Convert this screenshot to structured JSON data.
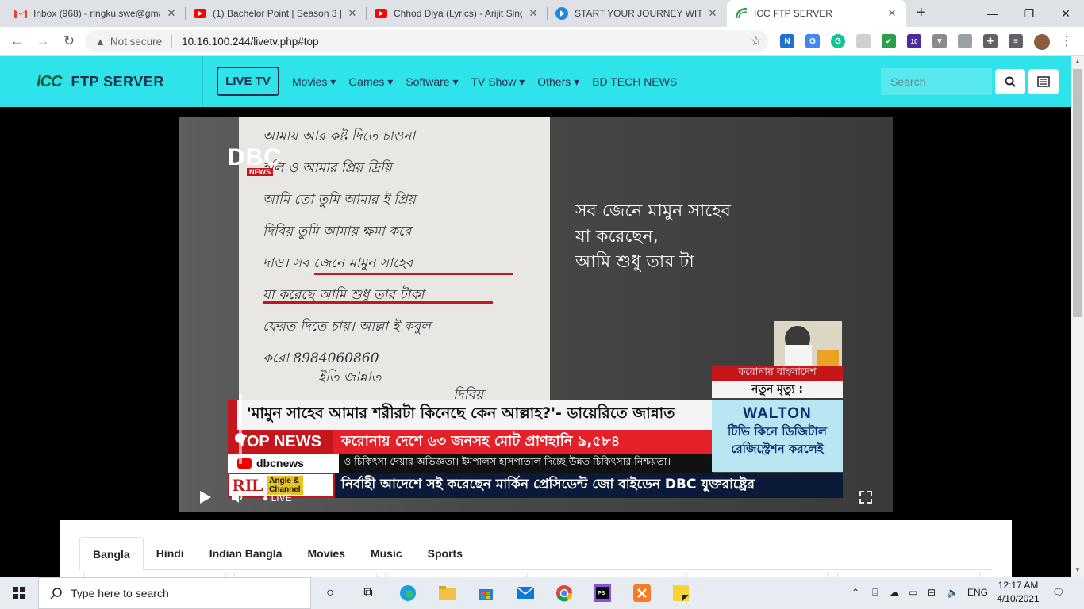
{
  "browser": {
    "tabs": [
      {
        "title": "Inbox (968) - ringku.swe@gma",
        "icon": "gmail-icon"
      },
      {
        "title": "(1) Bachelor Point | Season 3 |",
        "icon": "youtube-icon"
      },
      {
        "title": "Chhod Diya (Lyrics) - Arijit Sing",
        "icon": "youtube-icon"
      },
      {
        "title": "START YOUR JOURNEY WITH U",
        "icon": "app-icon"
      },
      {
        "title": "ICC FTP SERVER",
        "icon": "icc-icon",
        "active": true
      }
    ],
    "not_secure": "Not secure",
    "url": "10.16.100.244/livetv.php#top",
    "ext_badge": "10"
  },
  "site": {
    "logo_mark": "ICC",
    "logo_text": "FTP SERVER",
    "live_tv": "LIVE TV",
    "menu": [
      {
        "label": "Movies",
        "dropdown": true
      },
      {
        "label": "Games",
        "dropdown": true
      },
      {
        "label": "Software",
        "dropdown": true
      },
      {
        "label": "TV Show",
        "dropdown": true
      },
      {
        "label": "Others",
        "dropdown": true
      },
      {
        "label": "BD TECH NEWS",
        "dropdown": false
      }
    ],
    "search_placeholder": "Search"
  },
  "video": {
    "channel": "DBC",
    "channel_sub": "NEWS",
    "overlay_lines": [
      "সব জেনে মামুন সাহেব",
      "যা করেছেন,",
      "আমি শুধু তার টা"
    ],
    "headline": "'মামুন সাহেব আমার শরীরটা কিনেছে কেন আল্লাহ?'- ডায়েরিতে জান্নাত",
    "top_news": "TOP NEWS",
    "ticker_main": "করোনায় দেশে ৬৩ জনসহ মোট প্রাণহানি ৯,৫৮৪",
    "handle": "dbcnews",
    "ticker_sub": "ও চিকিৎসা দেয়ার অভিজ্ঞতা। ইমপালস হাসপাতাল দিচ্ছে উন্নত চিকিৎসার নিশ্চয়তা।",
    "sponsor": "RIL",
    "sponsor_tag_1": "Angle &",
    "sponsor_tag_2": "Channel",
    "ticker_bottom": "নির্বাহী আদেশে সই করেছেন মার্কিন প্রেসিডেন্ট জো বাইডেন DBC যুক্তরাষ্ট্রের",
    "side_red": "করোনায় বাংলাদেশ",
    "side_white": "নতুন মৃত্যু :",
    "walton": "WALTON",
    "walton_l1": "টিভি কিনে ডিজিটাল",
    "walton_l2": "রেজিস্ট্রেশন করলেই",
    "live_label": "LIVE",
    "note_lines": [
      "আমায় আর কষ্ট দিতে চাওনা",
      "হলি ও আমার প্রিয় দ্রিয়ি",
      "আমি তো তুমি আমার ই প্রিয়",
      "দিবিয় তুমি আমায় ক্ষমা করে",
      "দাও। সব জেনে মামুন সাহেব",
      "যা করেছে আমি শুধু তার টাকা",
      "ফেরত দিতে চায়। আল্লা ই কবুল",
      "করো   8984060860",
      "ইতি জান্নাত",
      "দিবিয়"
    ]
  },
  "content": {
    "tabs": [
      "Bangla",
      "Hindi",
      "Indian Bangla",
      "Movies",
      "Music",
      "Sports"
    ],
    "active_tab": "Bangla"
  },
  "taskbar": {
    "search_placeholder": "Type here to search",
    "lang": "ENG",
    "time": "12:17 AM",
    "date": "4/10/2021"
  },
  "colors": {
    "header": "#2ee3ea",
    "dbc_red": "#c5161c"
  }
}
